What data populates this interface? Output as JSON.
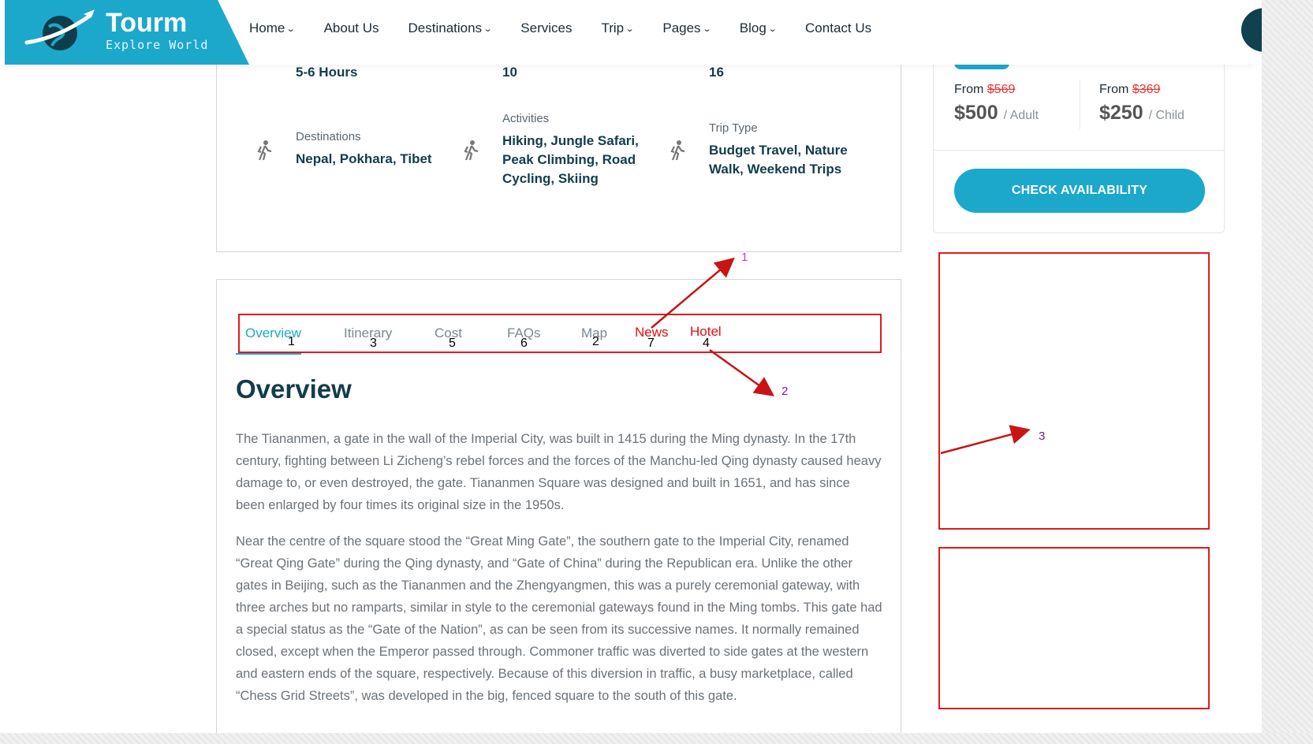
{
  "header": {
    "logo_title": "Tourm",
    "logo_subtitle": "Explore World",
    "nav": [
      {
        "label": "Home",
        "dropdown": true
      },
      {
        "label": "About Us",
        "dropdown": false
      },
      {
        "label": "Destinations",
        "dropdown": true
      },
      {
        "label": "Services",
        "dropdown": false
      },
      {
        "label": "Trip",
        "dropdown": true
      },
      {
        "label": "Pages",
        "dropdown": true
      },
      {
        "label": "Blog",
        "dropdown": true
      },
      {
        "label": "Contact Us",
        "dropdown": false
      }
    ]
  },
  "trip_info": {
    "duration_value": "5-6 Hours",
    "col2_value": "10",
    "col3_value": "16",
    "destinations_label": "Destinations",
    "destinations_value": "Nepal, Pokhara, Tibet",
    "activities_label": "Activities",
    "activities_value": "Hiking, Jungle Safari, Peak Climbing, Road Cycling, Skiing",
    "trip_type_label": "Trip Type",
    "trip_type_value": "Budget Travel, Nature Walk, Weekend Trips"
  },
  "tabs": [
    {
      "label": "Overview",
      "num": "1",
      "state": "active"
    },
    {
      "label": "Itinerary",
      "num": "3",
      "state": "normal"
    },
    {
      "label": "Cost",
      "num": "5",
      "state": "normal"
    },
    {
      "label": "FAQs",
      "num": "6",
      "state": "normal"
    },
    {
      "label": "Map",
      "num": "2",
      "state": "normal"
    },
    {
      "label": "News",
      "num": "7",
      "state": "highlight"
    },
    {
      "label": "Hotel",
      "num": "4",
      "state": "highlight"
    }
  ],
  "overview": {
    "title": "Overview",
    "paragraphs": [
      "The Tiananmen, a gate in the wall of the Imperial City, was built in 1415 during the Ming dynasty. In the 17th century, fighting between Li Zicheng’s rebel forces and the forces of the Manchu-led Qing dynasty caused heavy damage to, or even destroyed, the gate. Tiananmen Square was designed and built in 1651, and has since been enlarged by four times its original size in the 1950s.",
      "Near the centre of the square stood the “Great Ming Gate”, the southern gate to the Imperial City, renamed “Great Qing Gate” during the Qing dynasty, and “Gate of China” during the Republican era. Unlike the other gates in Beijing, such as the Tiananmen and the Zhengyangmen, this was a purely ceremonial gateway, with three arches but no ramparts, similar in style to the ceremonial gateways found in the Ming tombs. This gate had a special status as the “Gate of the Nation”, as can be seen from its successive names. It normally remained closed, except when the Emperor passed through. Commoner traffic was diverted to side gates at the western and eastern ends of the square, respectively. Because of this diversion in traffic, a busy marketplace, called “Chess Grid Streets”, was developed in the big, fenced square to the south of this gate."
    ]
  },
  "pricing": {
    "adult_from": "From",
    "adult_old": "$569",
    "adult_price": "$500",
    "adult_unit": "/ Adult",
    "child_from": "From",
    "child_old": "$369",
    "child_price": "$250",
    "child_unit": "/ Child",
    "cta": "CHECK AVAILABILITY"
  },
  "annotations": {
    "label1": "1",
    "label2": "2",
    "label3": "3"
  },
  "colors": {
    "brand": "#1ca8cb",
    "dark_text": "#123d4b",
    "annotation_red": "#e0191f",
    "annotation_label_1": "#d633d6",
    "annotation_label_2": "#7a1aa8"
  }
}
